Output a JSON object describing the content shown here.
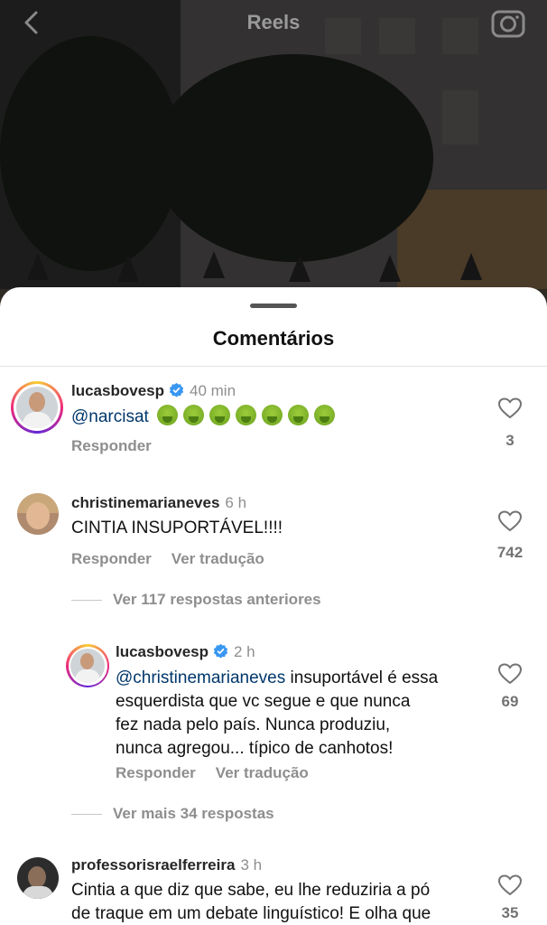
{
  "header": {
    "title": "Reels"
  },
  "sheet": {
    "title": "Comentários"
  },
  "comments": [
    {
      "username": "lucasbovesp",
      "verified": true,
      "time": "40 min",
      "mention": "@narcisat",
      "emoji_count": 7,
      "emoji": "nauseated-face-icon",
      "reply_label": "Responder",
      "likes": "3"
    },
    {
      "username": "christinemarianeves",
      "verified": false,
      "time": "6 h",
      "text": "CINTIA INSUPORTÁVEL!!!!",
      "reply_label": "Responder",
      "translate_label": "Ver tradução",
      "likes": "742",
      "view_previous_replies": "Ver 117 respostas anteriores"
    },
    {
      "username": "lucasbovesp",
      "verified": true,
      "time": "2 h",
      "mention": "@christinemarianeves",
      "line1": " insuportável é essa",
      "line2": "esquerdista que vc segue e que nunca",
      "line3": "fez nada pelo país. Nunca produziu,",
      "line4": "nunca agregou... típico de canhotos!",
      "reply_label": "Responder",
      "translate_label": "Ver tradução",
      "likes": "69",
      "view_more_replies": "Ver mais 34 respostas"
    },
    {
      "username": "professorisraelferreira",
      "verified": false,
      "time": "3 h",
      "line1": "Cintia a que diz que sabe, eu lhe reduziria a pó",
      "line2": "de traque em um debate linguístico! E olha que",
      "likes": "35"
    }
  ],
  "colors": {
    "mention": "#00376b",
    "verified": "#3897f0",
    "muted": "#8e8e8e"
  }
}
